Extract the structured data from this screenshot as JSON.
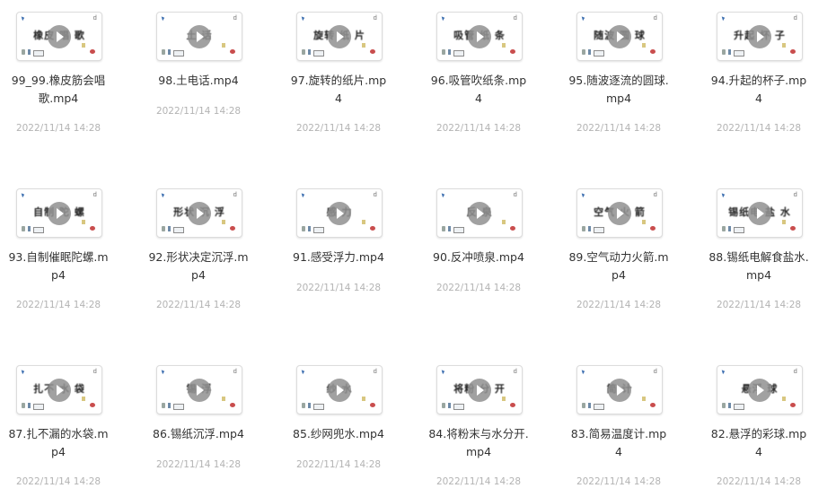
{
  "files": [
    {
      "name": "99_99.橡皮筋会唱歌.mp4",
      "thumb_text": "橡皮    唱 歌",
      "date": "2022/11/14 14:28",
      "lines": 2
    },
    {
      "name": "98.土电话.mp4",
      "thumb_text": "土   话",
      "date": "2022/11/14 14:28",
      "lines": 1
    },
    {
      "name": "97.旋转的纸片.mp4",
      "thumb_text": "旋转    纸 片",
      "date": "2022/11/14 14:28",
      "lines": 2
    },
    {
      "name": "96.吸管吹纸条.mp4",
      "thumb_text": "吸管    纸 条",
      "date": "2022/11/14 14:28",
      "lines": 2
    },
    {
      "name": "95.随波逐流的圆球.mp4",
      "thumb_text": "随波    圆 球",
      "date": "2022/11/14 14:28",
      "lines": 2
    },
    {
      "name": "94.升起的杯子.mp4",
      "thumb_text": "升起    杯 子",
      "date": "2022/11/14 14:28",
      "lines": 2
    },
    {
      "name": "93.自制催眠陀螺.mp4",
      "thumb_text": "自制    陀 螺",
      "date": "2022/11/14 14:28",
      "lines": 2
    },
    {
      "name": "92.形状决定沉浮.mp4",
      "thumb_text": "形状    沉 浮",
      "date": "2022/11/14 14:28",
      "lines": 2
    },
    {
      "name": "91.感受浮力.mp4",
      "thumb_text": "感    力",
      "date": "2022/11/14 14:28",
      "lines": 1
    },
    {
      "name": "90.反冲喷泉.mp4",
      "thumb_text": "反    泉",
      "date": "2022/11/14 14:28",
      "lines": 1
    },
    {
      "name": "89.空气动力火箭.mp4",
      "thumb_text": "空气    火 箭",
      "date": "2022/11/14 14:28",
      "lines": 2
    },
    {
      "name": "88.锡纸电解食盐水.mp4",
      "thumb_text": "锡纸电    盐 水",
      "date": "2022/11/14 14:28",
      "lines": 2
    },
    {
      "name": "87.扎不漏的水袋.mp4",
      "thumb_text": "扎不    水 袋",
      "date": "2022/11/14 14:28",
      "lines": 2
    },
    {
      "name": "86.锡纸沉浮.mp4",
      "thumb_text": "锡    浮",
      "date": "2022/11/14 14:28",
      "lines": 1
    },
    {
      "name": "85.纱网兜水.mp4",
      "thumb_text": "纱    水",
      "date": "2022/11/14 14:28",
      "lines": 1
    },
    {
      "name": "84.将粉末与水分开.mp4",
      "thumb_text": "将粉    分 开",
      "date": "2022/11/14 14:28",
      "lines": 2
    },
    {
      "name": "83.简易温度计.mp4",
      "thumb_text": "简    计",
      "date": "2022/11/14 14:28",
      "lines": 2
    },
    {
      "name": "82.悬浮的彩球.mp4",
      "thumb_text": "悬浮    球",
      "date": "2022/11/14 14:28",
      "lines": 2
    }
  ]
}
